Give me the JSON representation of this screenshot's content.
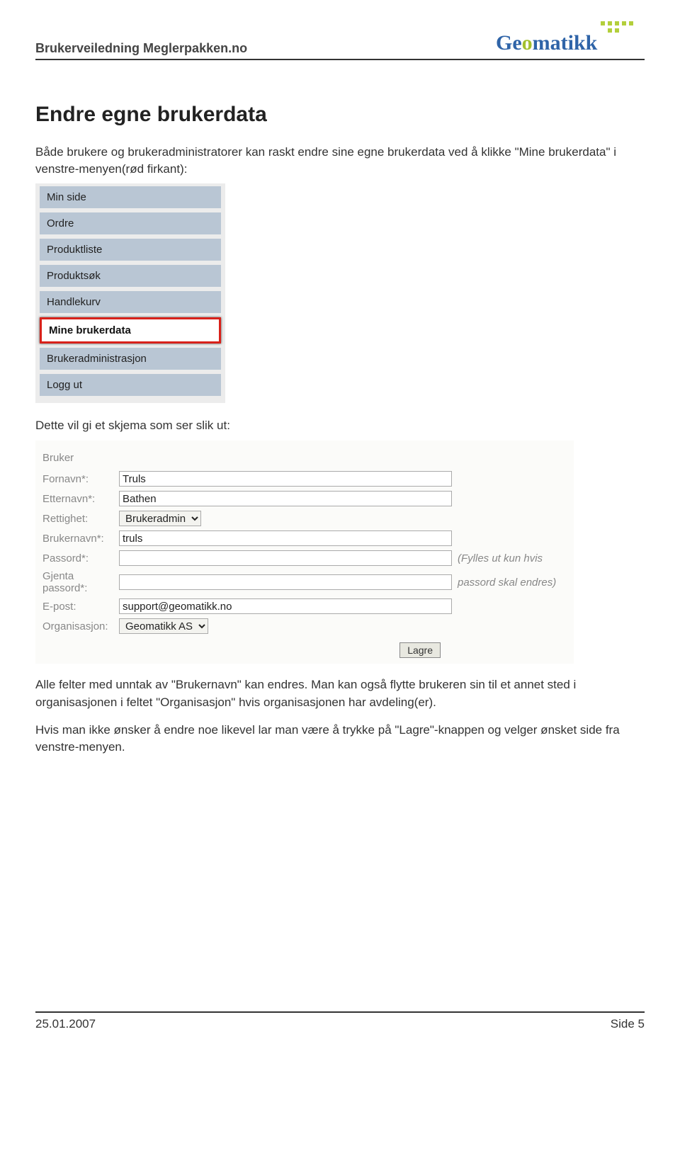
{
  "header": {
    "title": "Brukerveiledning Meglerpakken.no",
    "logo_text": "Geomatikk"
  },
  "page": {
    "title": "Endre egne brukerdata",
    "intro": "Både brukere og brukeradministratorer kan raskt endre sine egne brukerdata ved å klikke \"Mine brukerdata\" i venstre-menyen(rød firkant):",
    "post_menu_text": "Dette vil gi et skjema som ser slik ut:",
    "explain1": "Alle felter med unntak av \"Brukernavn\" kan endres. Man kan også flytte brukeren sin til et annet sted i organisasjonen i feltet \"Organisasjon\" hvis organisasjonen har avdeling(er).",
    "explain2": "Hvis man ikke ønsker å endre noe likevel lar man være å trykke på \"Lagre\"-knappen og velger ønsket side fra venstre-menyen."
  },
  "left_menu": {
    "items": [
      {
        "label": "Min side"
      },
      {
        "label": "Ordre"
      },
      {
        "label": "Produktliste"
      },
      {
        "label": "Produktsøk"
      },
      {
        "label": "Handlekurv"
      },
      {
        "label": "Mine brukerdata",
        "highlighted": true
      },
      {
        "label": "Brukeradministrasjon"
      },
      {
        "label": "Logg ut"
      }
    ]
  },
  "form": {
    "section_label": "Bruker",
    "fields": {
      "fornavn": {
        "label": "Fornavn*:",
        "value": "Truls"
      },
      "etternavn": {
        "label": "Etternavn*:",
        "value": "Bathen"
      },
      "rettighet": {
        "label": "Rettighet:",
        "value": "Brukeradmin"
      },
      "brukernavn": {
        "label": "Brukernavn*:",
        "value": "truls"
      },
      "passord": {
        "label": "Passord*:",
        "value": ""
      },
      "gjenta_passord": {
        "label": "Gjenta passord*:",
        "value": ""
      },
      "epost": {
        "label": "E-post:",
        "value": "support@geomatikk.no"
      },
      "organisasjon": {
        "label": "Organisasjon:",
        "value": "Geomatikk AS"
      }
    },
    "hint_line1": "(Fylles ut kun hvis",
    "hint_line2": "passord skal endres)",
    "save_label": "Lagre"
  },
  "footer": {
    "date": "25.01.2007",
    "page": "Side 5"
  }
}
